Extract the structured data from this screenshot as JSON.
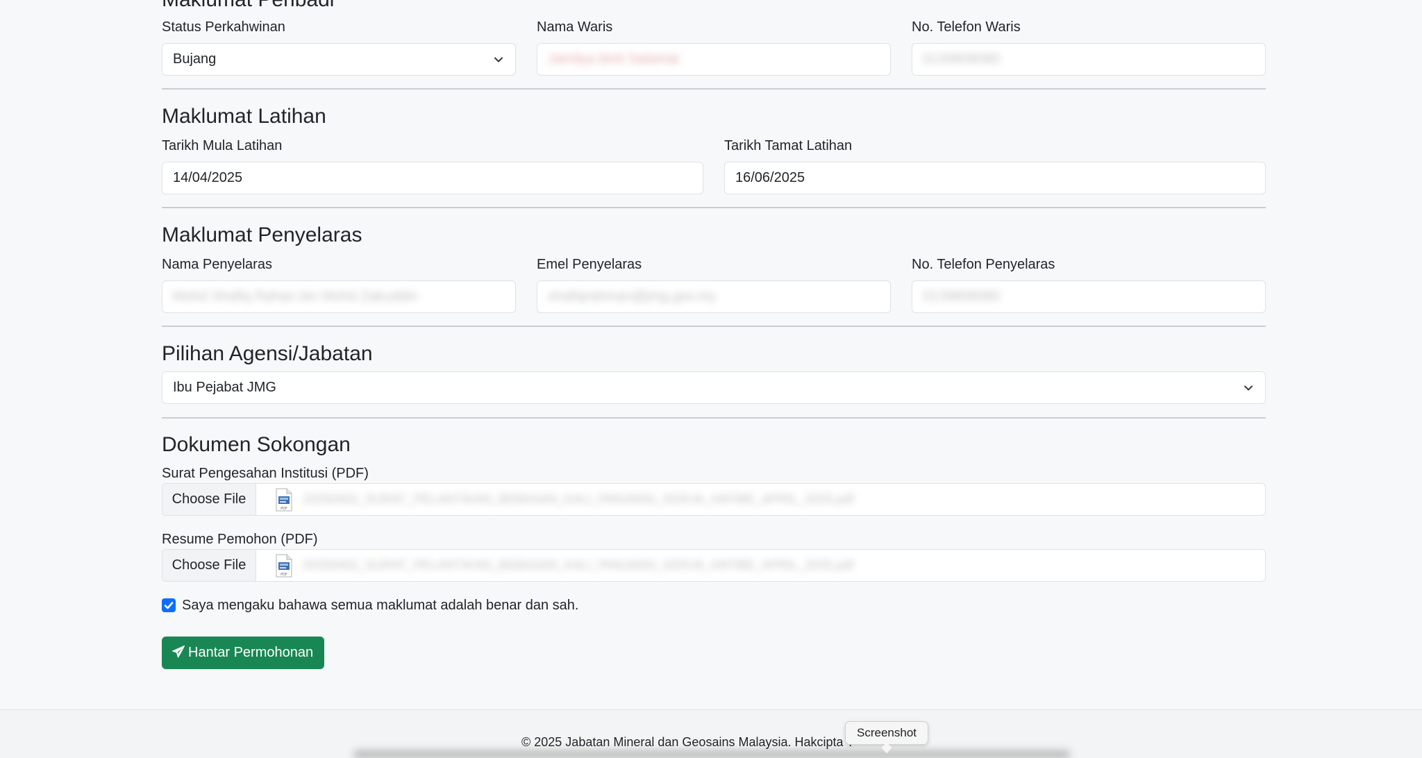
{
  "sections": {
    "personal": {
      "title": "Maklumat Peribadi",
      "marital_label": "Status Perkahwinan",
      "marital_value": "Bujang",
      "heir_name_label": "Nama Waris",
      "heir_name_value": "Jamilya binti Salamat",
      "heir_phone_label": "No. Telefon Waris",
      "heir_phone_value": "0139808080"
    },
    "training": {
      "title": "Maklumat Latihan",
      "start_label": "Tarikh Mula Latihan",
      "start_value": "14/04/2025",
      "end_label": "Tarikh Tamat Latihan",
      "end_value": "16/06/2025"
    },
    "coordinator": {
      "title": "Maklumat Penyelaras",
      "name_label": "Nama Penyelaras",
      "name_value": "Mohd Shafiq Rahan bin Mohd Zakuddin",
      "email_label": "Emel Penyelaras",
      "email_value": "shafiqrahman@jmg.gov.my",
      "phone_label": "No. Telefon Penyelaras",
      "phone_value": "0139808080"
    },
    "agency": {
      "title": "Pilihan Agensi/Jabatan",
      "value": "Ibu Pejabat JMG"
    },
    "documents": {
      "title": "Dokumen Sokongan",
      "letter_label": "Surat Pengesahan Institusi (PDF)",
      "resume_label": "Resume Pemohon (PDF)",
      "choose_file": "Choose File",
      "letter_file": "20250402_SURAT_PELANTIKAN_BEBASAN_KALI_PANJANG_KERJA_HATIBE_APRIL_2025.pdf",
      "resume_file": "20250402_SURAT_PELANTIKAN_BEBASAN_KALI_PANJANG_KERJA_HATIBE_APRIL_2025.pdf"
    }
  },
  "declaration": {
    "checked": true,
    "label": "Saya mengaku bahawa semua maklumat adalah benar dan sah."
  },
  "submit": {
    "label": "Hantar Permohonan",
    "color": "#198754"
  },
  "footer": {
    "text": "© 2025 Jabatan Mineral dan Geosains Malaysia. Hakcipta T"
  },
  "tooltip": {
    "text": "Screenshot"
  },
  "colors": {
    "primary": "#0d6efd",
    "success": "#198754",
    "background": "#f7f8f9"
  }
}
